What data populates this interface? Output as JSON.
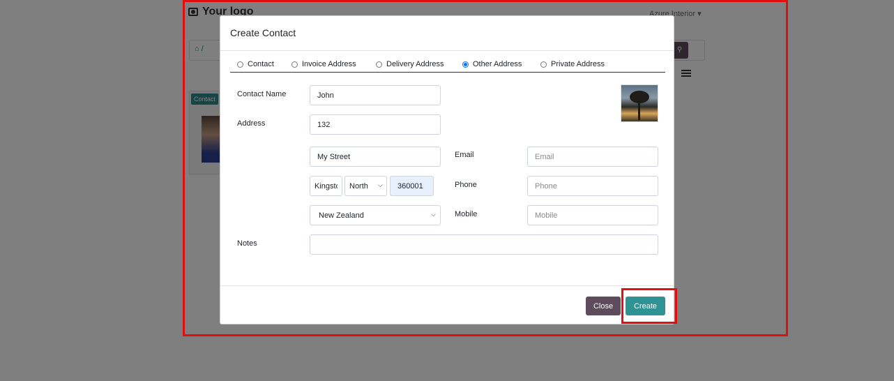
{
  "background": {
    "logo_text": "Your logo",
    "company": "Azure Interior",
    "breadcrumb": "/",
    "card_badge": "Contact"
  },
  "modal": {
    "title": "Create Contact",
    "address_types": [
      {
        "label": "Contact",
        "checked": false
      },
      {
        "label": "Invoice Address",
        "checked": false
      },
      {
        "label": "Delivery Address",
        "checked": false
      },
      {
        "label": "Other Address",
        "checked": true
      },
      {
        "label": "Private Address",
        "checked": false
      }
    ],
    "form": {
      "contact_name_label": "Contact Name",
      "contact_name_value": "John",
      "address_label": "Address",
      "street_value": "132",
      "street2_value": "My Street",
      "city_value": "Kingston",
      "state_value": "North",
      "zip_value": "360001",
      "country_value": "New Zealand",
      "email_label": "Email",
      "email_placeholder": "Email",
      "phone_label": "Phone",
      "phone_placeholder": "Phone",
      "mobile_label": "Mobile",
      "mobile_placeholder": "Mobile",
      "notes_label": "Notes",
      "notes_value": ""
    },
    "buttons": {
      "close_label": "Close",
      "create_label": "Create"
    }
  },
  "colors": {
    "close_button": "#5e4b5c",
    "create_button": "#2f9294",
    "highlight": "#e01010",
    "radio_checked": "#0d6efd"
  }
}
